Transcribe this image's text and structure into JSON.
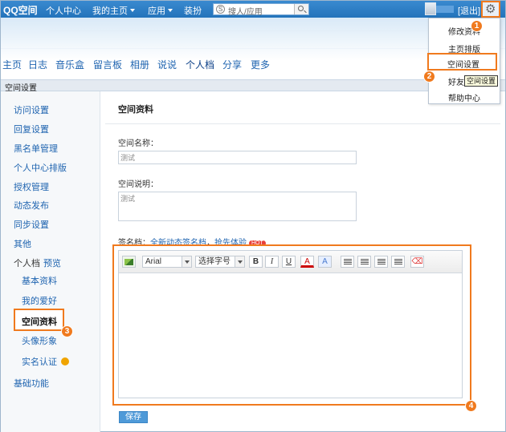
{
  "topnav": {
    "logo": "QQ空间",
    "items": [
      "个人中心",
      "我的主页",
      "应用",
      "装扮"
    ],
    "search_placeholder": "搜人/应用",
    "logout": "[退出]"
  },
  "mainnav": {
    "items": [
      "主页",
      "日志",
      "音乐盒",
      "留言板",
      "相册",
      "说说",
      "个人档",
      "分享",
      "更多"
    ],
    "active": "个人档"
  },
  "section_bar": "空间设置",
  "sidebar": {
    "items": [
      "访问设置",
      "回复设置",
      "黑名单管理",
      "个人中心排版",
      "授权管理",
      "动态发布",
      "同步设置",
      "其他"
    ],
    "group_label": "个人档",
    "group_preview": "预览",
    "sub_items": [
      "基本资料",
      "我的爱好",
      "空间资料",
      "头像形象",
      "实名认证"
    ],
    "active": "空间资料",
    "bottom_item": "基础功能"
  },
  "panel": {
    "title": "空间资料",
    "name_label": "空间名称：",
    "name_value": "测试",
    "desc_label": "空间说明：",
    "desc_value": "测试",
    "sig_label": "签名档：",
    "sig_link1": "全新动态签名档",
    "sig_sep": "，",
    "sig_link2": "抢先体验",
    "hot": "HOT",
    "save": "保存"
  },
  "editor_toolbar": {
    "font": "Arial",
    "size": "选择字号",
    "bold": "B",
    "italic": "I",
    "underline": "U",
    "color": "A",
    "bg": "A"
  },
  "dropdown": {
    "items": [
      "修改资料",
      "主页排版",
      "空间设置",
      "好友管理",
      "帮助中心"
    ],
    "active": "空间设置",
    "tooltip": "空间设置"
  },
  "steps": [
    "1",
    "2",
    "3",
    "4"
  ],
  "colors": {
    "highlight": "#f07a1e",
    "topbar": "#2373bb",
    "link": "#1f64b0"
  }
}
